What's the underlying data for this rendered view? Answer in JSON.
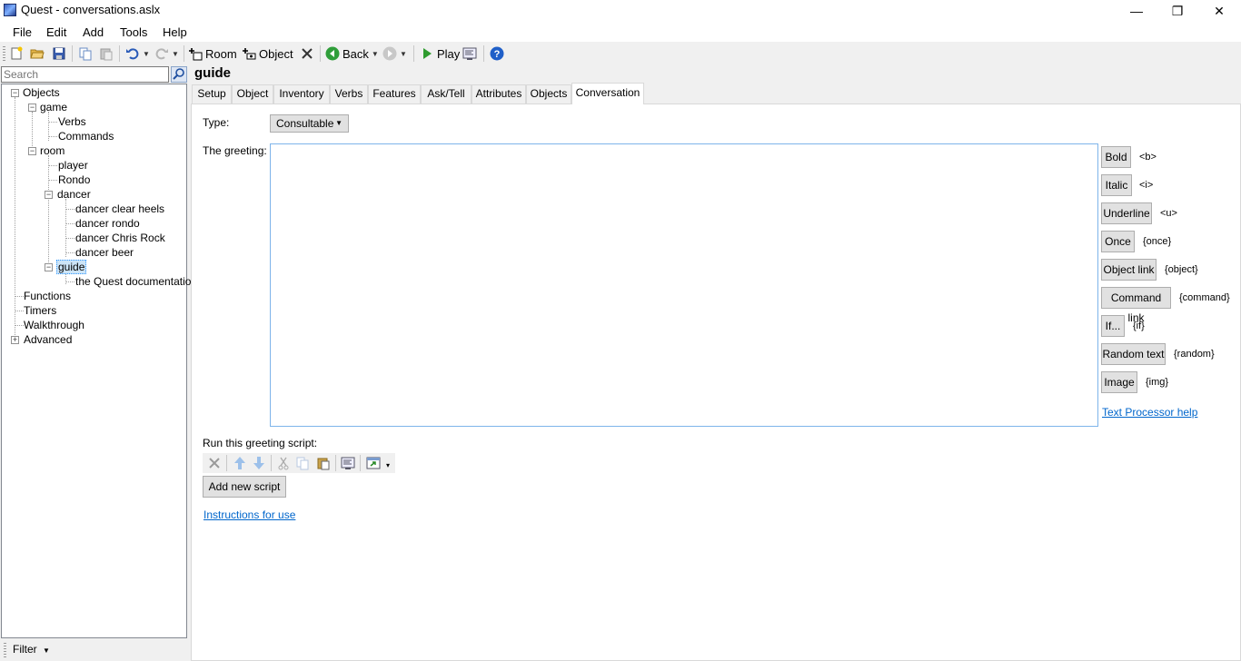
{
  "window": {
    "title": "Quest - conversations.aslx",
    "minimize": "—",
    "restore": "❐",
    "close": "✕"
  },
  "menu": [
    {
      "label": "File"
    },
    {
      "label": "Edit"
    },
    {
      "label": "Add"
    },
    {
      "label": "Tools"
    },
    {
      "label": "Help"
    }
  ],
  "toolbar": {
    "room_label": "Room",
    "object_label": "Object",
    "back_label": "Back",
    "play_label": "Play"
  },
  "search": {
    "placeholder": "Search"
  },
  "tree": {
    "objects": "Objects",
    "game": "game",
    "verbs": "Verbs",
    "commands": "Commands",
    "room": "room",
    "player": "player",
    "rondo": "Rondo",
    "dancer": "dancer",
    "dancer_clear_heels": "dancer clear heels",
    "dancer_rondo": "dancer rondo",
    "dancer_chris_rock": "dancer Chris Rock",
    "dancer_beer": "dancer beer",
    "guide": "guide",
    "quest_doc": "the Quest documentation",
    "functions": "Functions",
    "timers": "Timers",
    "walkthrough": "Walkthrough",
    "advanced": "Advanced"
  },
  "filter": {
    "label": "Filter"
  },
  "editor": {
    "object_name": "guide",
    "tabs": [
      "Setup",
      "Object",
      "Inventory",
      "Verbs",
      "Features",
      "Ask/Tell",
      "Attributes",
      "Objects",
      "Conversation"
    ],
    "type_label": "Type:",
    "type_value": "Consultable",
    "greeting_label": "The greeting:",
    "greeting_text": "",
    "format_buttons": [
      {
        "label": "Bold",
        "tag": "<b>"
      },
      {
        "label": "Italic",
        "tag": "<i>"
      },
      {
        "label": "Underline",
        "tag": "<u>"
      },
      {
        "label": "Once",
        "tag": "{once}"
      },
      {
        "label": "Object link",
        "tag": "{object}"
      },
      {
        "label": "Command link",
        "tag": "{command}"
      },
      {
        "label": "If...",
        "tag": "{if}"
      },
      {
        "label": "Random text",
        "tag": "{random}"
      },
      {
        "label": "Image",
        "tag": "{img}"
      }
    ],
    "text_processor_help": "Text Processor help",
    "script_label": "Run this greeting script:",
    "add_script": "Add new script",
    "instructions": "Instructions for use"
  }
}
